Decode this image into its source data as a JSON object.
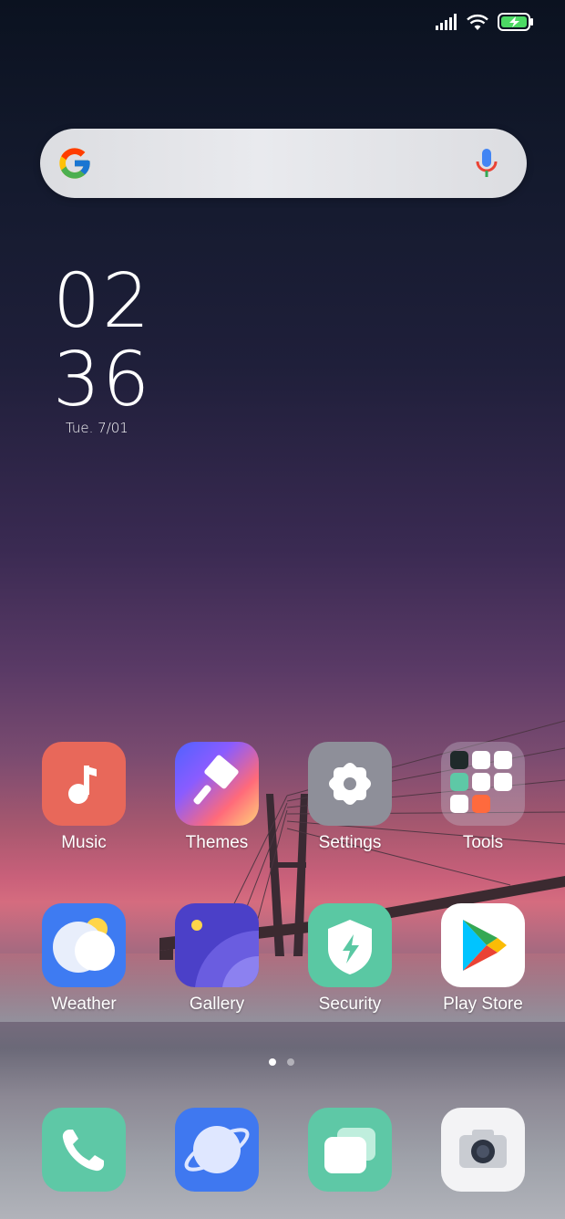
{
  "status_bar": {
    "icons": [
      "signal-icon",
      "wifi-icon",
      "battery-charging-icon"
    ]
  },
  "search": {
    "brand_icon": "google-g-icon",
    "mic_icon": "microphone-icon"
  },
  "clock": {
    "hours": "02",
    "minutes": "36",
    "date": "Tue. 7/01"
  },
  "apps": [
    {
      "label": "Music",
      "icon": "music-note-icon",
      "color": "#e8685a"
    },
    {
      "label": "Themes",
      "icon": "paintbrush-icon",
      "color": "#5b6cff"
    },
    {
      "label": "Settings",
      "icon": "gear-icon",
      "color": "#8e8f99"
    },
    {
      "label": "Tools",
      "icon": "folder-icon",
      "color": "#6c6a78"
    },
    {
      "label": "Weather",
      "icon": "weather-icon",
      "color": "#3e7bf2"
    },
    {
      "label": "Gallery",
      "icon": "gallery-icon",
      "color": "#4b40c8"
    },
    {
      "label": "Security",
      "icon": "shield-icon",
      "color": "#5ac8a3"
    },
    {
      "label": "Play Store",
      "icon": "play-store-icon",
      "color": "#ffffff"
    }
  ],
  "pager": {
    "pages": 2,
    "current": 1
  },
  "dock": [
    {
      "name": "Phone",
      "icon": "phone-icon",
      "color": "#5ec8a6"
    },
    {
      "name": "Browser",
      "icon": "planet-icon",
      "color": "#3f78f0"
    },
    {
      "name": "Messaging",
      "icon": "chat-bubble-icon",
      "color": "#5ec8a6"
    },
    {
      "name": "Camera",
      "icon": "camera-icon",
      "color": "#f3f3f5"
    }
  ]
}
